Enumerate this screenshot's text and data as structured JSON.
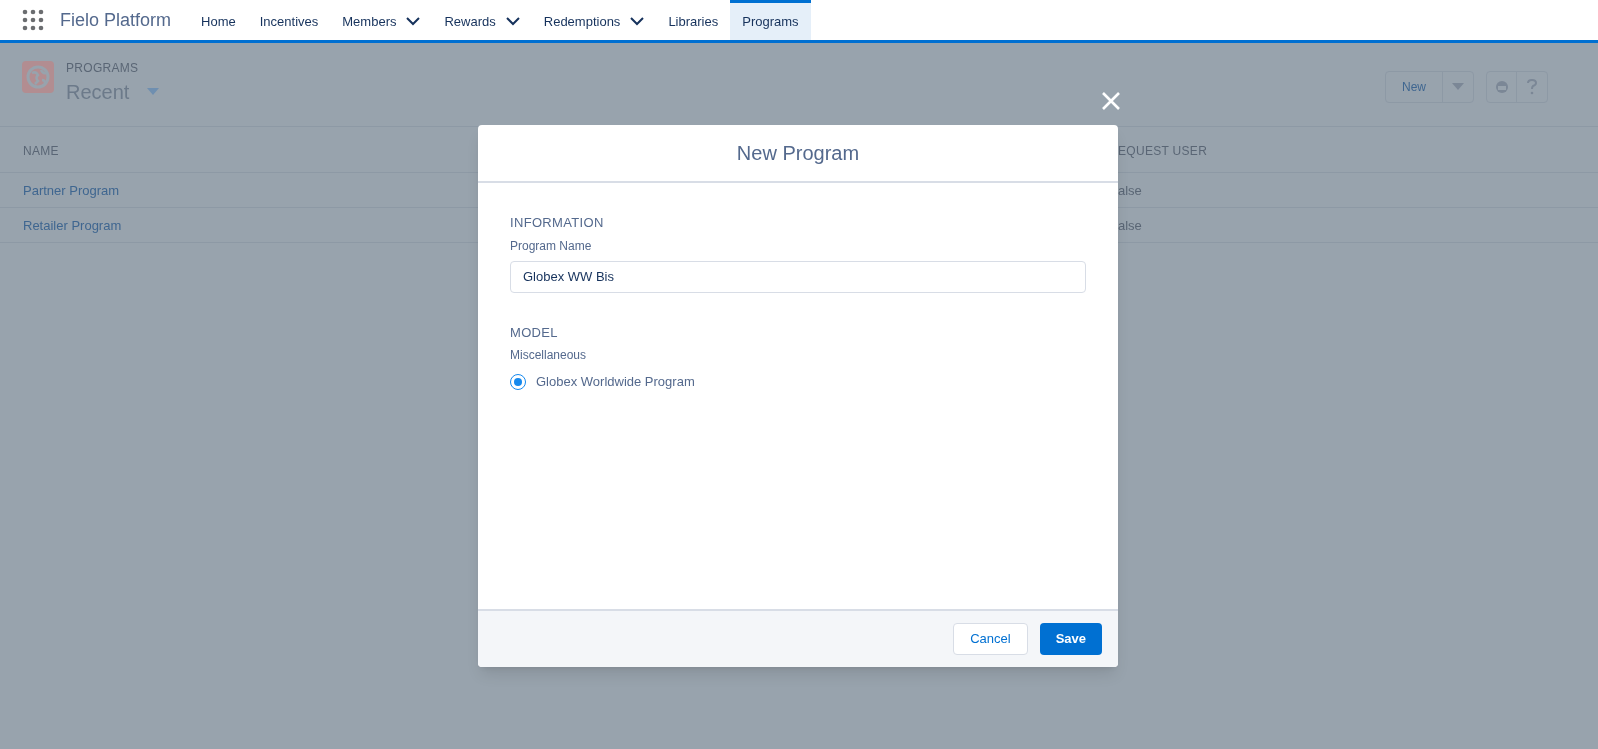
{
  "app": {
    "name": "Fielo Platform"
  },
  "nav": [
    {
      "label": "Home",
      "dropdown": false,
      "selected": false
    },
    {
      "label": "Incentives",
      "dropdown": false,
      "selected": false
    },
    {
      "label": "Members",
      "dropdown": true,
      "selected": false
    },
    {
      "label": "Rewards",
      "dropdown": true,
      "selected": false
    },
    {
      "label": "Redemptions",
      "dropdown": true,
      "selected": false
    },
    {
      "label": "Libraries",
      "dropdown": false,
      "selected": false
    },
    {
      "label": "Programs",
      "dropdown": false,
      "selected": true
    }
  ],
  "list_header": {
    "object_label": "PROGRAMS",
    "view": "Recent",
    "buttons": [
      {
        "label": "New"
      }
    ]
  },
  "table": {
    "columns": [
      "NAME",
      "EQUEST USER"
    ],
    "rows": [
      [
        "Partner Program",
        "alse"
      ],
      [
        "Retailer Program",
        "alse"
      ]
    ]
  },
  "modal": {
    "title": "New Program",
    "sections": [
      {
        "heading": "INFORMATION",
        "kind": "text",
        "label": "Program Name",
        "value": "Globex WW Bis"
      },
      {
        "heading": "MODEL",
        "kind": "radio",
        "label": "Miscellaneous",
        "options": [
          {
            "label": "Globex Worldwide Program",
            "selected": true
          }
        ]
      }
    ],
    "buttons": [
      {
        "label": "Cancel",
        "kind": "neutral"
      },
      {
        "label": "Save",
        "kind": "brand"
      }
    ]
  }
}
